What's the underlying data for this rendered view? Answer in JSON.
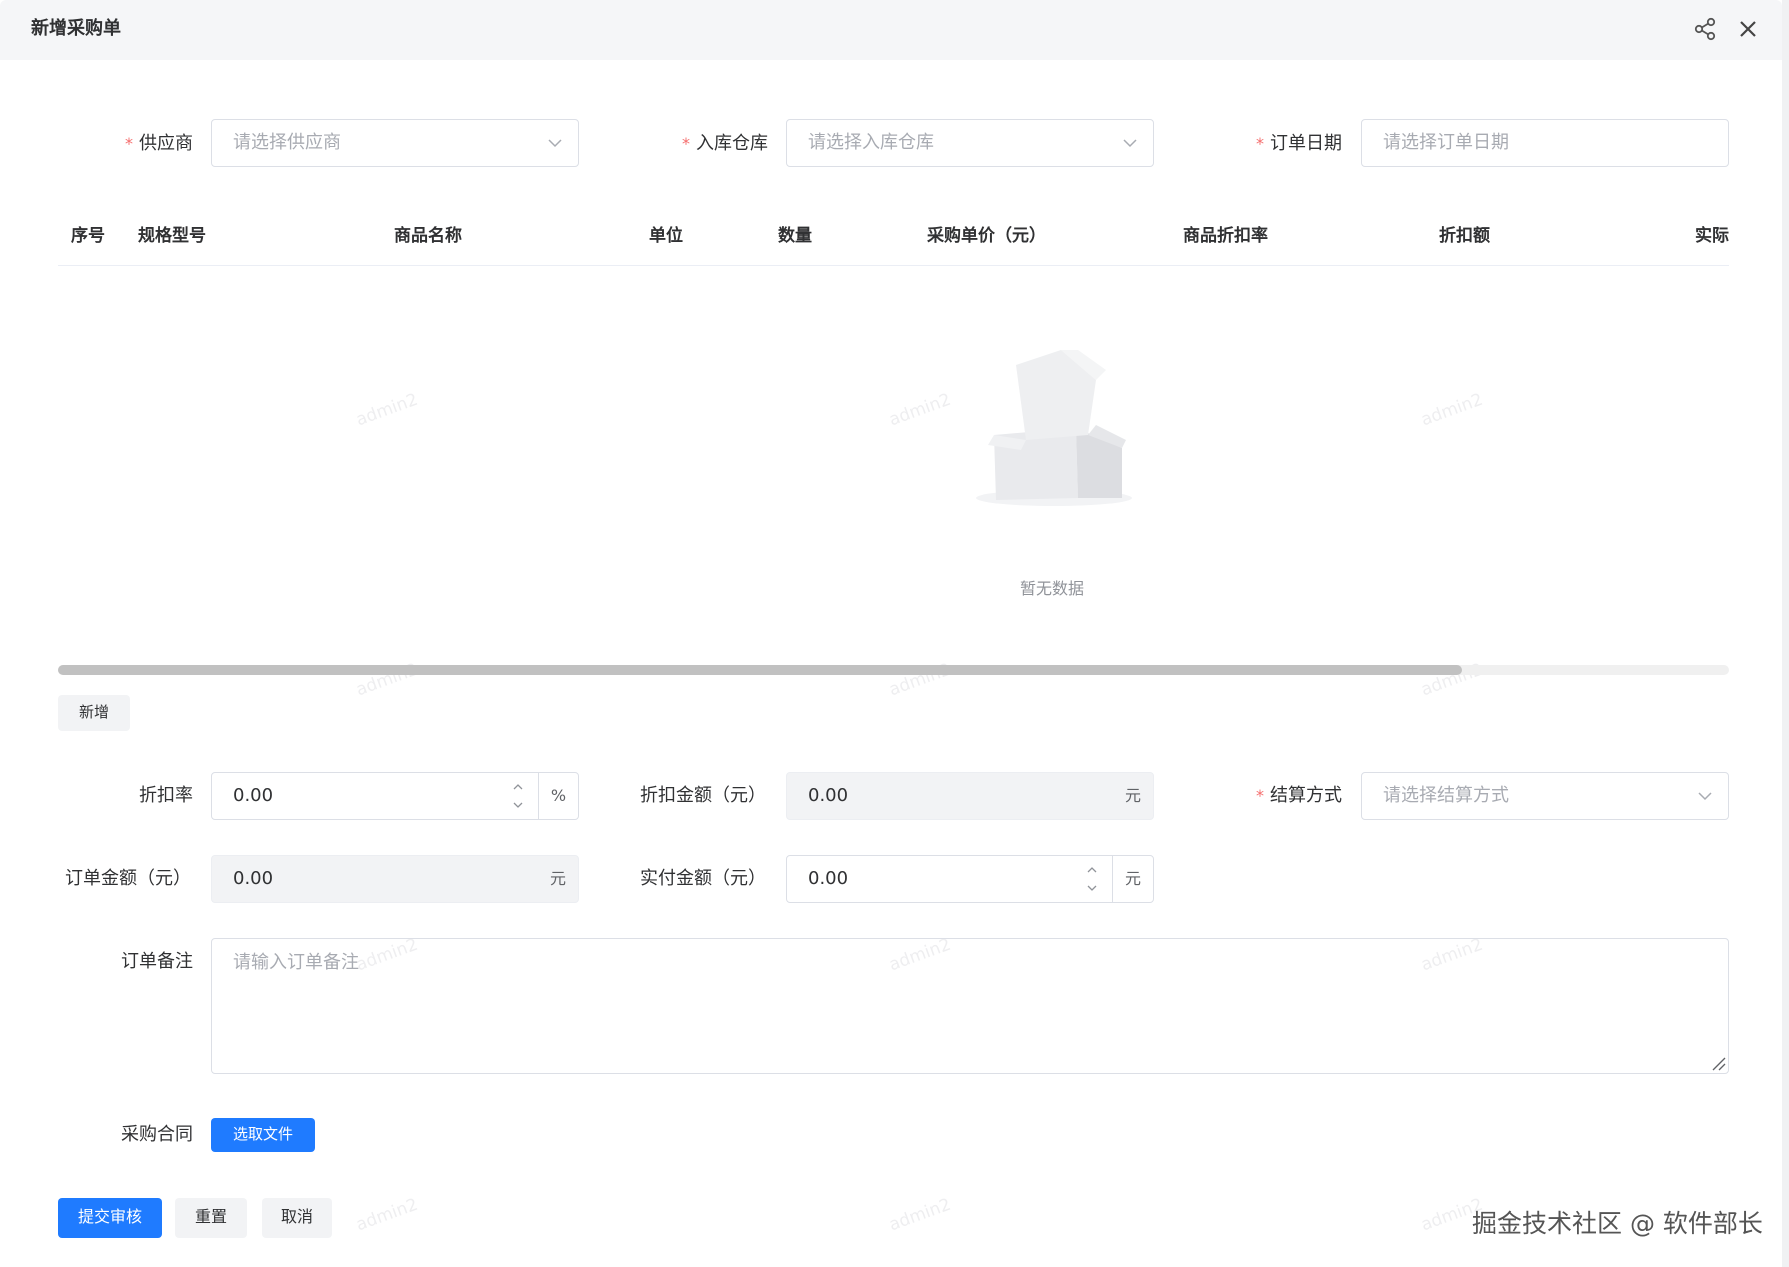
{
  "dialog": {
    "title": "新增采购单",
    "icons": [
      "share-icon",
      "close-icon"
    ]
  },
  "watermark": "admin2",
  "fields": {
    "supplier": {
      "label": "供应商",
      "placeholder": "请选择供应商"
    },
    "warehouse": {
      "label": "入库仓库",
      "placeholder": "请选择入库仓库"
    },
    "order_date": {
      "label": "订单日期",
      "placeholder": "请选择订单日期"
    },
    "discount_rate": {
      "label": "折扣率",
      "value": "0.00",
      "unit": "%"
    },
    "discount_amount": {
      "label": "折扣金额（元）",
      "value": "0.00",
      "unit": "元"
    },
    "settlement": {
      "label": "结算方式",
      "placeholder": "请选择结算方式"
    },
    "order_amount": {
      "label": "订单金额（元）",
      "value": "0.00",
      "unit": "元"
    },
    "paid_amount": {
      "label": "实付金额（元）",
      "value": "0.00",
      "unit": "元"
    },
    "remark": {
      "label": "订单备注",
      "placeholder": "请输入订单备注"
    },
    "contract": {
      "label": "采购合同",
      "button": "选取文件"
    }
  },
  "table": {
    "columns": [
      "序号",
      "规格型号",
      "商品名称",
      "单位",
      "数量",
      "采购单价（元）",
      "商品折扣率",
      "折扣额",
      "实际"
    ],
    "empty_text": "暂无数据",
    "scroll_position": 0.84,
    "add_button": "新增"
  },
  "actions": {
    "submit": "提交审核",
    "reset": "重置",
    "cancel": "取消"
  },
  "credit": "掘金技术社区 @ 软件部长",
  "colors": {
    "primary": "#1f7bff",
    "required": "#f56c6c",
    "header_bg": "#f5f6f8"
  }
}
